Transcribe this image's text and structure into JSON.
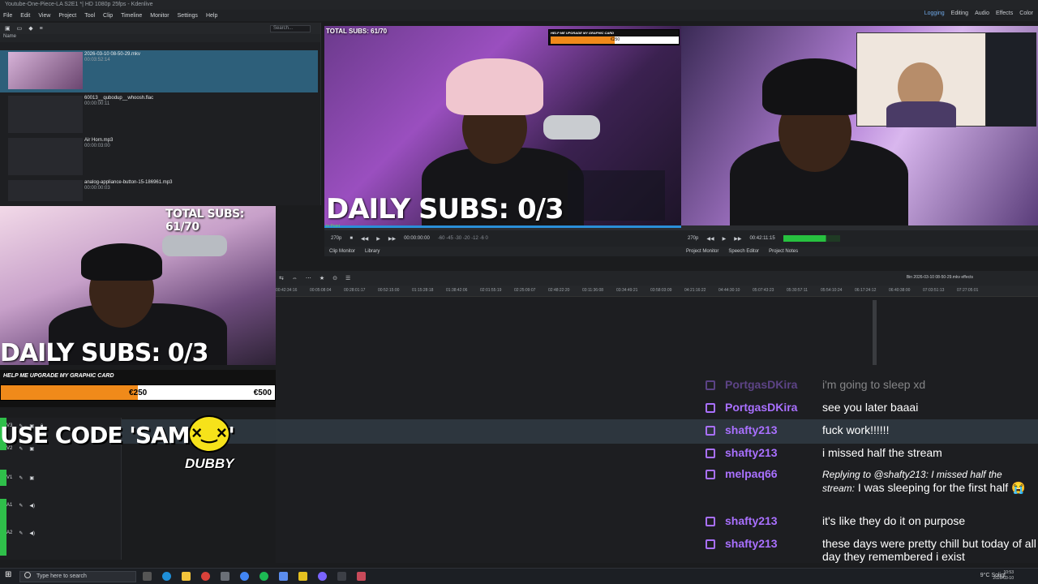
{
  "window": {
    "title": "Youtube-One-Piece-LA S2E1 *| HD 1080p 25fps - Kdenlive"
  },
  "menu": [
    "File",
    "Edit",
    "View",
    "Project",
    "Tool",
    "Clip",
    "Timeline",
    "Monitor",
    "Settings",
    "Help"
  ],
  "workspaces": [
    "Logging",
    "Editing",
    "Audio",
    "Effects",
    "Color"
  ],
  "bin": {
    "search_placeholder": "Search...",
    "column_name": "Name",
    "items": [
      {
        "name": "2026-03-10 08-50-29.mkv",
        "duration": "00:03:52:14"
      },
      {
        "name": "60013__qubodup__whoosh.flac",
        "duration": "00:00:00:11"
      },
      {
        "name": "Air Horn.mp3",
        "duration": "00:00:03:00"
      },
      {
        "name": "analog-appliance-button-15-186961.mp3",
        "duration": "00:00:00:03"
      }
    ]
  },
  "clip_monitor": {
    "total_subs": "TOTAL SUBS: 61/70",
    "daily_subs": "DAILY SUBS: 0/3",
    "donation_title": "HELP ME UPGRADE MY GRAPHIC CARD",
    "donation_current": "€250",
    "timecode": "00:00:00:00",
    "zoom": "270p",
    "in_point": "In Point"
  },
  "project_monitor": {
    "timecode": "00:42:11:15",
    "zoom": "270p"
  },
  "monitor_tabs_left": [
    "Clip Monitor",
    "Library"
  ],
  "monitor_tabs_right": [
    "Project Monitor",
    "Speech Editor",
    "Project Notes"
  ],
  "timeline": {
    "effects_label": "Bin 2026-03-10 08-50-29.mkv effects",
    "ruler_ticks": [
      "00:42:34:16",
      "00:05:08:04",
      "00:28:01:17",
      "00:52:15:00",
      "01:15:28:18",
      "01:38:42:06",
      "02:01:55:19",
      "02:25:09:07",
      "02:48:22:20",
      "03:11:36:08",
      "03:34:49:21",
      "03:58:03:09",
      "04:21:16:22",
      "04:44:30:10",
      "05:07:43:23",
      "05:30:57:11",
      "05:54:10:24",
      "06:17:24:12",
      "06:40:38:00",
      "07:03:51:13",
      "07:27:05:01"
    ],
    "tracks": [
      "V3",
      "V2",
      "V1",
      "A1",
      "A2"
    ]
  },
  "overlay": {
    "total_subs": "TOTAL SUBS: 61/70",
    "daily_subs": "DAILY SUBS: 0/3",
    "donation_title": "HELP ME UPGRADE MY GRAPHIC CARD",
    "donation_current": "€250",
    "donation_goal": "€500",
    "donation_progress": 0.5,
    "promo": "USE CODE 'SAMISY'",
    "sponsor": "DUBBY"
  },
  "chat": [
    {
      "user": "PortgasDKira",
      "text": "i'm going to sleep xd",
      "faded": true
    },
    {
      "user": "PortgasDKira",
      "text": "see you later baaai"
    },
    {
      "user": "shafty213",
      "text": "fuck work!!!!!!"
    },
    {
      "user": "shafty213",
      "text": "i missed half the stream"
    },
    {
      "user": "melpaq66",
      "reply": "Replying to @shafty213: I missed half the stream:",
      "text": "I was sleeping for the first half 😭"
    },
    {
      "user": "shafty213",
      "text": "it's like they do it on purpose"
    },
    {
      "user": "shafty213",
      "text": "these days were pretty chill but today of all day they remembered i exist"
    }
  ],
  "taskbar": {
    "search_placeholder": "Type here to search",
    "weather": "9°C Sołigt",
    "time": "10:53",
    "date": "2026-03-10"
  }
}
